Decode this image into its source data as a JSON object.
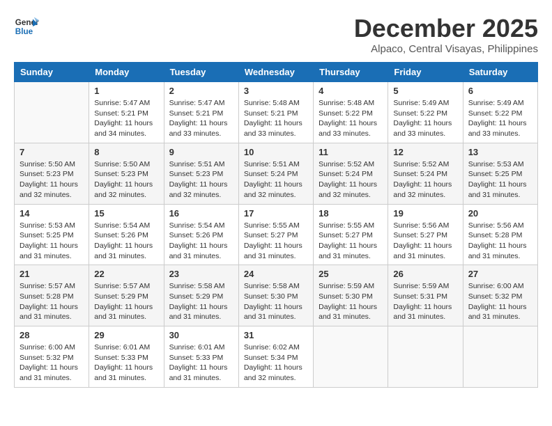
{
  "header": {
    "logo_line1": "General",
    "logo_line2": "Blue",
    "title": "December 2025",
    "subtitle": "Alpaco, Central Visayas, Philippines"
  },
  "weekdays": [
    "Sunday",
    "Monday",
    "Tuesday",
    "Wednesday",
    "Thursday",
    "Friday",
    "Saturday"
  ],
  "weeks": [
    [
      {
        "day": "",
        "info": ""
      },
      {
        "day": "1",
        "info": "Sunrise: 5:47 AM\nSunset: 5:21 PM\nDaylight: 11 hours\nand 34 minutes."
      },
      {
        "day": "2",
        "info": "Sunrise: 5:47 AM\nSunset: 5:21 PM\nDaylight: 11 hours\nand 33 minutes."
      },
      {
        "day": "3",
        "info": "Sunrise: 5:48 AM\nSunset: 5:21 PM\nDaylight: 11 hours\nand 33 minutes."
      },
      {
        "day": "4",
        "info": "Sunrise: 5:48 AM\nSunset: 5:22 PM\nDaylight: 11 hours\nand 33 minutes."
      },
      {
        "day": "5",
        "info": "Sunrise: 5:49 AM\nSunset: 5:22 PM\nDaylight: 11 hours\nand 33 minutes."
      },
      {
        "day": "6",
        "info": "Sunrise: 5:49 AM\nSunset: 5:22 PM\nDaylight: 11 hours\nand 33 minutes."
      }
    ],
    [
      {
        "day": "7",
        "info": "Sunrise: 5:50 AM\nSunset: 5:23 PM\nDaylight: 11 hours\nand 32 minutes."
      },
      {
        "day": "8",
        "info": "Sunrise: 5:50 AM\nSunset: 5:23 PM\nDaylight: 11 hours\nand 32 minutes."
      },
      {
        "day": "9",
        "info": "Sunrise: 5:51 AM\nSunset: 5:23 PM\nDaylight: 11 hours\nand 32 minutes."
      },
      {
        "day": "10",
        "info": "Sunrise: 5:51 AM\nSunset: 5:24 PM\nDaylight: 11 hours\nand 32 minutes."
      },
      {
        "day": "11",
        "info": "Sunrise: 5:52 AM\nSunset: 5:24 PM\nDaylight: 11 hours\nand 32 minutes."
      },
      {
        "day": "12",
        "info": "Sunrise: 5:52 AM\nSunset: 5:24 PM\nDaylight: 11 hours\nand 32 minutes."
      },
      {
        "day": "13",
        "info": "Sunrise: 5:53 AM\nSunset: 5:25 PM\nDaylight: 11 hours\nand 31 minutes."
      }
    ],
    [
      {
        "day": "14",
        "info": "Sunrise: 5:53 AM\nSunset: 5:25 PM\nDaylight: 11 hours\nand 31 minutes."
      },
      {
        "day": "15",
        "info": "Sunrise: 5:54 AM\nSunset: 5:26 PM\nDaylight: 11 hours\nand 31 minutes."
      },
      {
        "day": "16",
        "info": "Sunrise: 5:54 AM\nSunset: 5:26 PM\nDaylight: 11 hours\nand 31 minutes."
      },
      {
        "day": "17",
        "info": "Sunrise: 5:55 AM\nSunset: 5:27 PM\nDaylight: 11 hours\nand 31 minutes."
      },
      {
        "day": "18",
        "info": "Sunrise: 5:55 AM\nSunset: 5:27 PM\nDaylight: 11 hours\nand 31 minutes."
      },
      {
        "day": "19",
        "info": "Sunrise: 5:56 AM\nSunset: 5:27 PM\nDaylight: 11 hours\nand 31 minutes."
      },
      {
        "day": "20",
        "info": "Sunrise: 5:56 AM\nSunset: 5:28 PM\nDaylight: 11 hours\nand 31 minutes."
      }
    ],
    [
      {
        "day": "21",
        "info": "Sunrise: 5:57 AM\nSunset: 5:28 PM\nDaylight: 11 hours\nand 31 minutes."
      },
      {
        "day": "22",
        "info": "Sunrise: 5:57 AM\nSunset: 5:29 PM\nDaylight: 11 hours\nand 31 minutes."
      },
      {
        "day": "23",
        "info": "Sunrise: 5:58 AM\nSunset: 5:29 PM\nDaylight: 11 hours\nand 31 minutes."
      },
      {
        "day": "24",
        "info": "Sunrise: 5:58 AM\nSunset: 5:30 PM\nDaylight: 11 hours\nand 31 minutes."
      },
      {
        "day": "25",
        "info": "Sunrise: 5:59 AM\nSunset: 5:30 PM\nDaylight: 11 hours\nand 31 minutes."
      },
      {
        "day": "26",
        "info": "Sunrise: 5:59 AM\nSunset: 5:31 PM\nDaylight: 11 hours\nand 31 minutes."
      },
      {
        "day": "27",
        "info": "Sunrise: 6:00 AM\nSunset: 5:32 PM\nDaylight: 11 hours\nand 31 minutes."
      }
    ],
    [
      {
        "day": "28",
        "info": "Sunrise: 6:00 AM\nSunset: 5:32 PM\nDaylight: 11 hours\nand 31 minutes."
      },
      {
        "day": "29",
        "info": "Sunrise: 6:01 AM\nSunset: 5:33 PM\nDaylight: 11 hours\nand 31 minutes."
      },
      {
        "day": "30",
        "info": "Sunrise: 6:01 AM\nSunset: 5:33 PM\nDaylight: 11 hours\nand 31 minutes."
      },
      {
        "day": "31",
        "info": "Sunrise: 6:02 AM\nSunset: 5:34 PM\nDaylight: 11 hours\nand 32 minutes."
      },
      {
        "day": "",
        "info": ""
      },
      {
        "day": "",
        "info": ""
      },
      {
        "day": "",
        "info": ""
      }
    ]
  ]
}
